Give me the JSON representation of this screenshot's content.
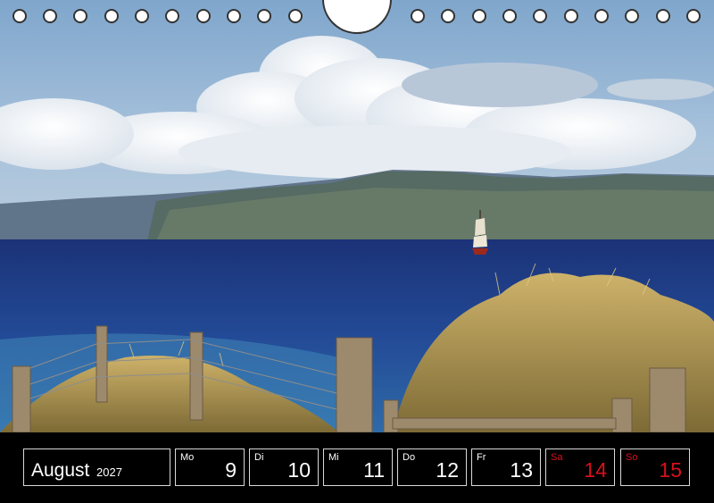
{
  "calendar": {
    "month": "August",
    "year": "2027",
    "days": [
      {
        "weekday": "Mo",
        "date": "9",
        "weekend": false
      },
      {
        "weekday": "Di",
        "date": "10",
        "weekend": false
      },
      {
        "weekday": "Mi",
        "date": "11",
        "weekend": false
      },
      {
        "weekday": "Do",
        "date": "12",
        "weekend": false
      },
      {
        "weekday": "Fr",
        "date": "13",
        "weekend": false
      },
      {
        "weekday": "Sa",
        "date": "14",
        "weekend": true
      },
      {
        "weekday": "So",
        "date": "15",
        "weekend": true
      }
    ]
  },
  "colors": {
    "sky": "#8fb3d4",
    "sea": "#1f3f8a",
    "grass": "#b39a52",
    "weekend_text": "#d8101a",
    "strip_background": "#000000"
  },
  "icons": {
    "binding_hole": "binding-hole-icon",
    "hanger_hole": "hanger-hole-icon"
  }
}
